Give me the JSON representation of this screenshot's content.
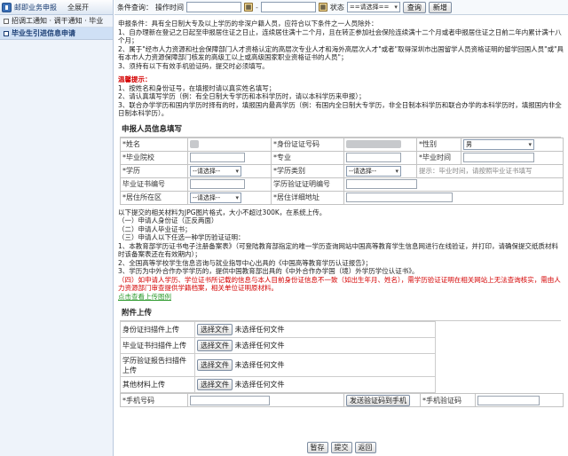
{
  "sidebar": {
    "title": "邮即业务申报",
    "expand_all": "全展开",
    "items": [
      {
        "label": "招调工通知 · 调干通知 · 毕业",
        "icon": "checkbox-icon"
      },
      {
        "label": "毕业生引进信息申请",
        "icon": "folder-icon"
      }
    ]
  },
  "search": {
    "label": "条件查询：",
    "field_label": "操作时间",
    "status_label": "状态",
    "status_value": "==请选择==",
    "query_btn": "查询",
    "add_btn": "新增"
  },
  "intro": {
    "lines": [
      "申报条件：具有全日制大专及以上学历的非深户籍人员，应符合以下条件之一人员除外：",
      "1、自办理新在登记之日起至申报居住证之日止，连续居住满十二个月，且在转正参加社会保险连续满十二个月或者申报居住证之日前二年内累计满十八个月；",
      "2、属于\"经市人力资源和社会保障部门人才资格认定的高层次专业人才和海外高层次人才\"或者\"取得深圳市出国留学人员资格证明的留学回国人员\"或\"具有本市人力资源保障部门核发的高级工以上或高级国家职业资格证书的人员\"；",
      "3、须持有以下有效手机验证码，提交时必须填写。"
    ],
    "warn_title": "温馨提示：",
    "warn_lines": [
      "1、按姓名和身份证号，在填报时请以真实姓名填写；",
      "2、请认真填写学历（例：有全日制大专学历和本科学历时，请以本科学历来申报）；",
      "3、联合办学学历和国内学历时择有的时，填报国内最高学历（例：有国内全日制大专学历，非全日制本科学历和联合办学的本科学历时，填报国内非全日制本科学历）。"
    ]
  },
  "applicant": {
    "section_title": "申报人员信息填写",
    "name_label": "*姓名",
    "id_label": "*身份证证号码",
    "gender_label": "*性别",
    "gender_value": "男",
    "school_label": "*毕业院校",
    "major_label": "*专业",
    "grad_time_label": "*毕业时间",
    "degree_label": "*学历",
    "degree_value": "--请选择--",
    "degree_type_label": "*学历类别",
    "degree_type_value": "--请选择--",
    "degree_hint": "提示：毕业时间，请按照毕业证书填写",
    "cert_label": "毕业证书编号",
    "degree_cert_label": "学历验证证明编号",
    "residence_label": "*居住所在区",
    "residence_value": "--请选择--",
    "address_label": "*居住详细地址"
  },
  "materials": {
    "intro": "以下提交的相关材料为JPG图片格式，大小不超过300K，在系统上传。",
    "list": [
      "（一）申请人身份证（正反两面）",
      "（二）申请人毕业证书；",
      "（三）申请人以下任选一种学历验证证明：",
      "1、本教育部学历证书电子注册备案表》（可登陆教育部指定的唯一学历查询网站中国高等教育学生信息网进行在线验证，并打印，请确保提交纸质材料时该备案表还在有效期内）；",
      "2、全国高等学校学生信息咨询与就业指导中心出具的《中国高等教育学历认证报告》；",
      "3、学历为中外合作办学学历的，提供中国教育部出具的《中外合作办学国（境）外学历学位认证书》。"
    ],
    "warn": "（四）如申请人学历、学位证书所记载的信息与本人目前身份证信息不一致（如出生年月、姓名），需学历验证证明在相关网站上无法查询核实，需由人力资源部门审查提供学籍档案，相关单位证明原材料。",
    "link": "点击查看上传图例"
  },
  "upload": {
    "section_title": "附件上传",
    "rows": [
      {
        "label": "身份证扫描件上传",
        "button": "选择文件",
        "status": "未选择任何文件"
      },
      {
        "label": "毕业证书扫描件上传",
        "button": "选择文件",
        "status": "未选择任何文件"
      },
      {
        "label": "学历验证报告扫描件上传",
        "button": "选择文件",
        "status": "未选择任何文件"
      },
      {
        "label": "其他材料上传",
        "button": "选择文件",
        "status": "未选择任何文件"
      }
    ],
    "phone_label": "*手机号码",
    "send_code_btn": "发送验证码到手机",
    "code_label": "*手机验证码"
  },
  "actions": {
    "save": "暂存",
    "submit": "提交",
    "back": "返回"
  }
}
